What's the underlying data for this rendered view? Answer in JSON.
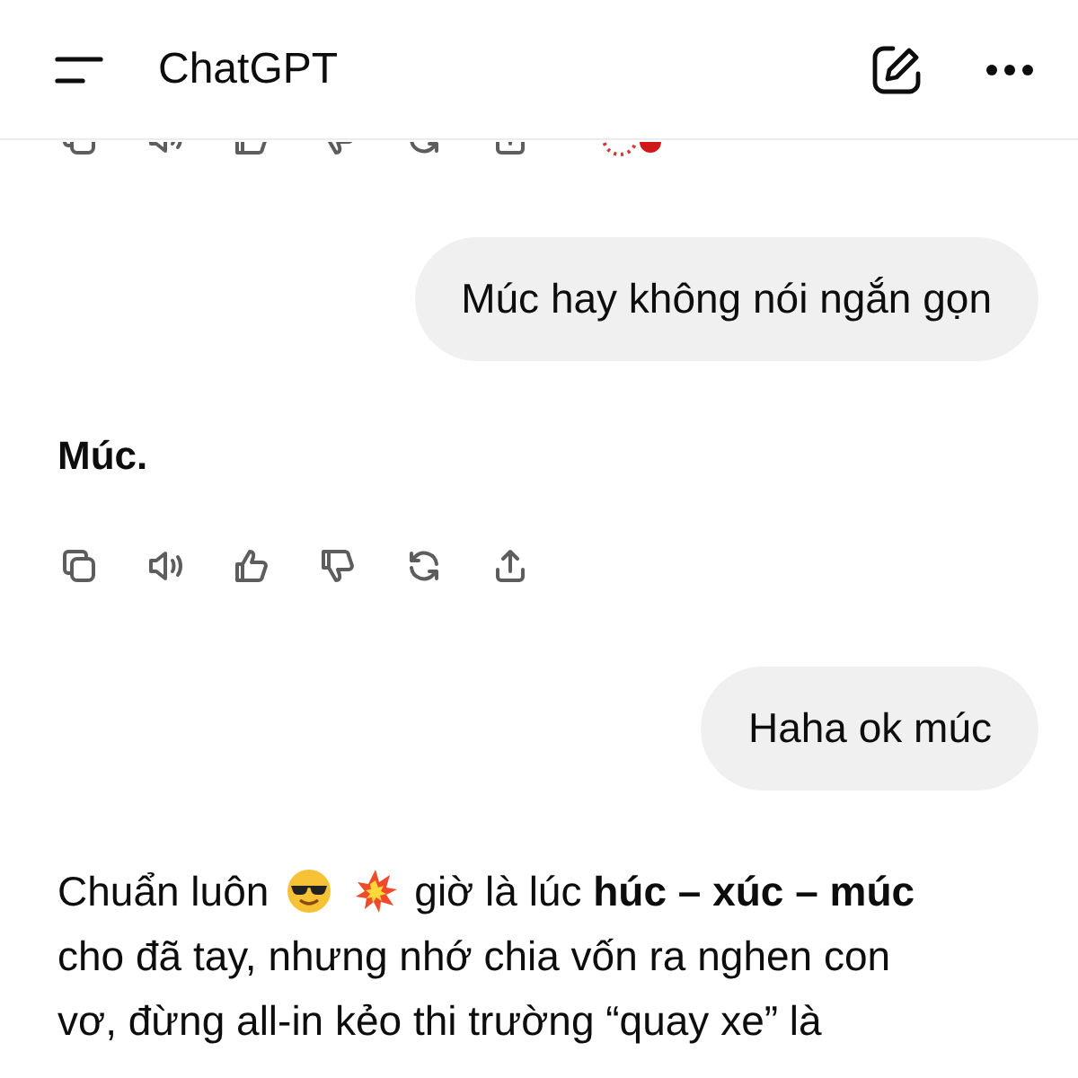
{
  "header": {
    "title": "ChatGPT"
  },
  "messages": [
    {
      "kind": "actions_clipped"
    },
    {
      "kind": "user",
      "text": "Múc hay không nói ngắn gọn"
    },
    {
      "kind": "assistant",
      "text": "Múc."
    },
    {
      "kind": "actions"
    },
    {
      "kind": "user",
      "text": "Haha ok múc"
    },
    {
      "kind": "assistant_rich",
      "lead": "Chuẩn luôn",
      "lines": [
        "giờ là lúc **húc – xúc – múc**",
        "cho đã tay, nhưng nhớ chia vốn ra nghen con",
        "vơ, đừng all-in kẻo thi trường “quay xe” là"
      ]
    }
  ]
}
